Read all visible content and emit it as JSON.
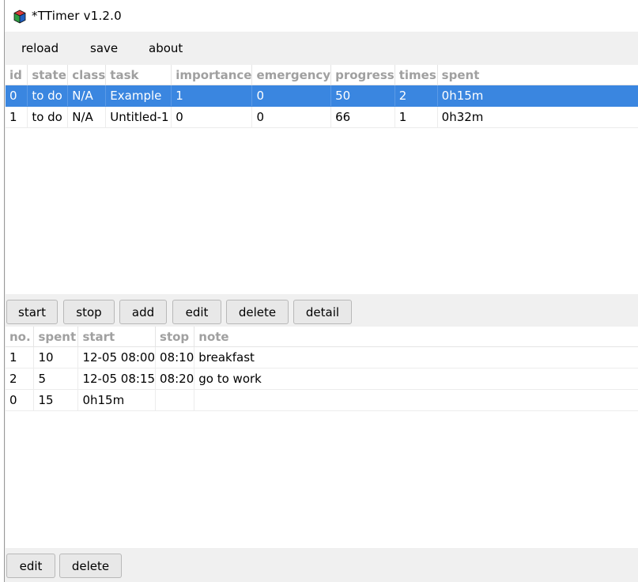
{
  "window": {
    "title": "*TTimer v1.2.0"
  },
  "menu": {
    "reload": "reload",
    "save": "save",
    "about": "about"
  },
  "tasks": {
    "columns": [
      "id",
      "state",
      "class",
      "task",
      "importance",
      "emergency",
      "progress",
      "times",
      "spent"
    ],
    "rows": [
      [
        "0",
        "to do",
        "N/A",
        "Example",
        "1",
        "0",
        "50",
        "2",
        "0h15m"
      ],
      [
        "1",
        "to do",
        "N/A",
        "Untitled-1",
        "0",
        "0",
        "66",
        "1",
        "0h32m"
      ]
    ],
    "selected_row": 0
  },
  "task_buttons": {
    "start": "start",
    "stop": "stop",
    "add": "add",
    "edit": "edit",
    "delete": "delete",
    "detail": "detail"
  },
  "sessions": {
    "columns": [
      "no.",
      "spent",
      "start",
      "stop",
      "note"
    ],
    "rows": [
      [
        "1",
        "10",
        "12-05 08:00",
        "08:10",
        "breakfast"
      ],
      [
        "2",
        "5",
        "12-05 08:15",
        "08:20",
        "go to work"
      ],
      [
        "0",
        "15",
        "0h15m",
        "",
        ""
      ]
    ]
  },
  "session_buttons": {
    "edit": "edit",
    "delete": "delete"
  },
  "colors": {
    "selection": "#3a86e0",
    "header_text": "#a0a0a0"
  },
  "icons": {
    "app": "cube-app-icon"
  }
}
